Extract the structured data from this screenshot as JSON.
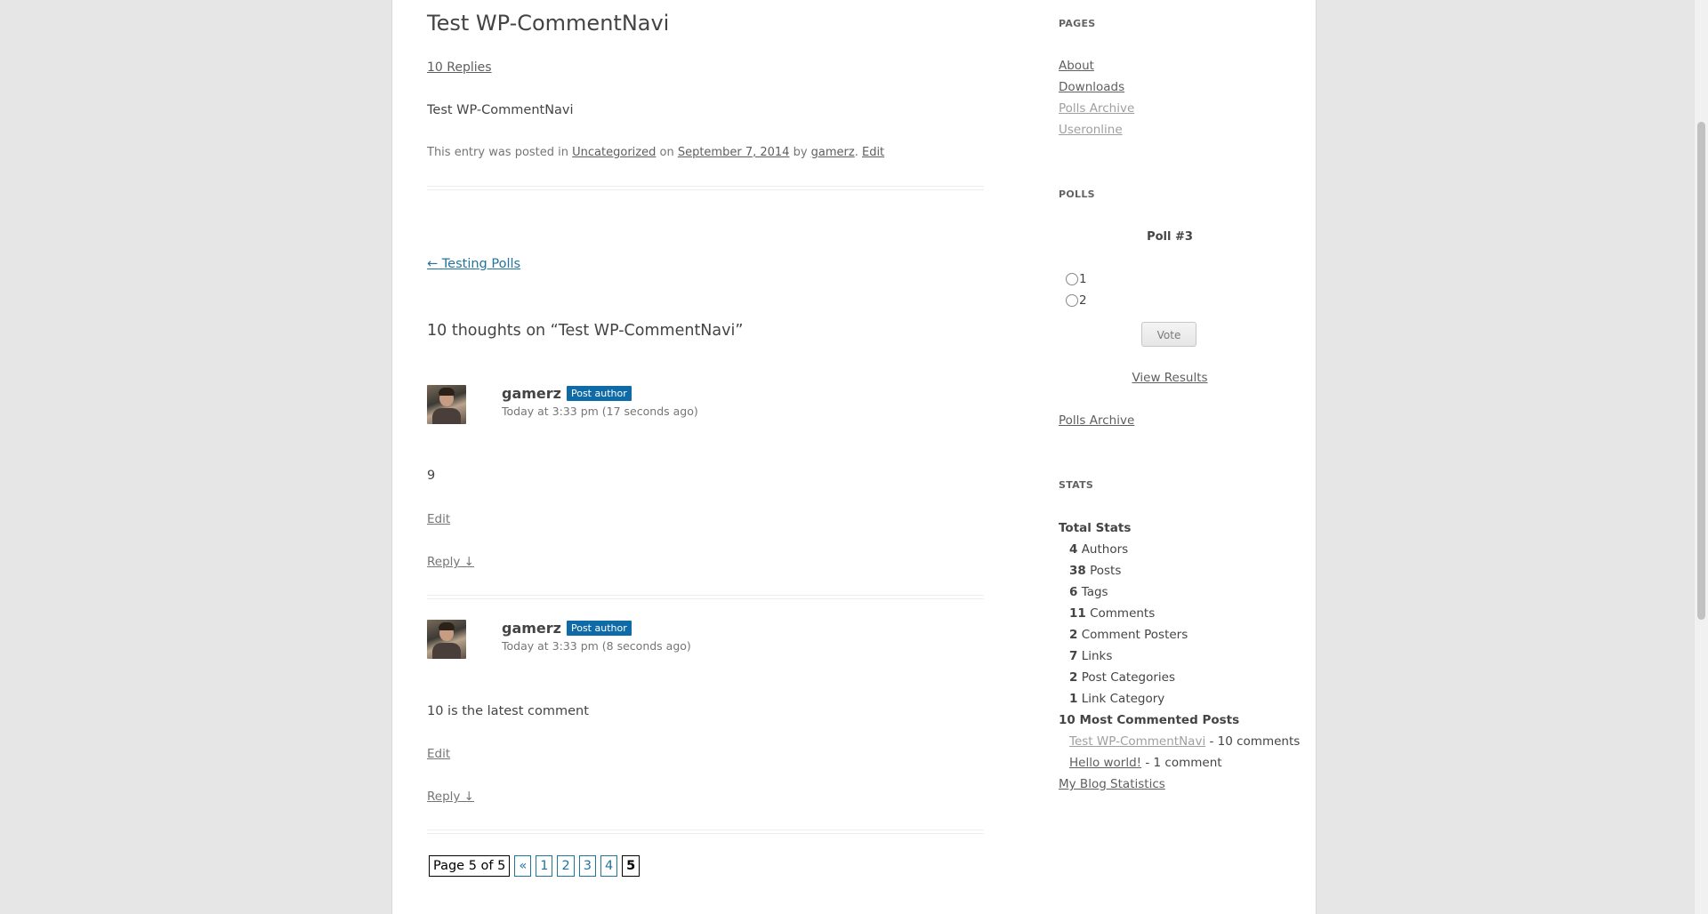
{
  "post": {
    "title": "Test WP-CommentNavi",
    "replies_link": "10 Replies",
    "body": "Test WP-CommentNavi",
    "meta_prefix": "This entry was posted in ",
    "category": "Uncategorized",
    "meta_on": " on ",
    "date": "September 7, 2014",
    "meta_by": " by ",
    "author": "gamerz",
    "meta_dot": ". ",
    "edit": "Edit"
  },
  "nav": {
    "prev_link": "← Testing Polls"
  },
  "comments": {
    "title": "10 thoughts on “Test WP-CommentNavi”",
    "items": [
      {
        "author": "gamerz",
        "badge": "Post author",
        "time": "Today at 3:33 pm (17 seconds ago)",
        "text": "9",
        "edit": "Edit",
        "reply": "Reply ↓"
      },
      {
        "author": "gamerz",
        "badge": "Post author",
        "time": "Today at 3:33 pm (8 seconds ago)",
        "text": "10 is the latest comment",
        "edit": "Edit",
        "reply": "Reply ↓"
      }
    ]
  },
  "pagination": {
    "label": "Page 5 of 5",
    "prev": "«",
    "pages": [
      "1",
      "2",
      "3",
      "4"
    ],
    "current": "5"
  },
  "sidebar": {
    "pages_title": "Pages",
    "pages": [
      "About",
      "Downloads",
      "Polls Archive",
      "Useronline"
    ],
    "polls_title": "Polls",
    "poll_question": "Poll #3",
    "poll_options": [
      "1",
      "2"
    ],
    "vote_label": "Vote",
    "view_results": "View Results",
    "polls_archive": "Polls Archive",
    "stats_title": "Stats",
    "total_stats": "Total Stats",
    "stats": [
      {
        "num": "4",
        "label": " Authors"
      },
      {
        "num": "38",
        "label": " Posts"
      },
      {
        "num": "6",
        "label": " Tags"
      },
      {
        "num": "11",
        "label": " Comments"
      },
      {
        "num": "2",
        "label": " Comment Posters"
      },
      {
        "num": "7",
        "label": " Links"
      },
      {
        "num": "2",
        "label": " Post Categories"
      },
      {
        "num": "1",
        "label": " Link Category"
      }
    ],
    "most_commented_title": "10 Most Commented Posts",
    "most_commented": [
      {
        "title": "Test WP-CommentNavi",
        "count": " - 10 comments"
      },
      {
        "title": "Hello world!",
        "count": " - 1 comment"
      }
    ],
    "my_blog_stats": "My Blog Statistics"
  },
  "colors": {
    "link_blue": "#21759b",
    "badge_blue": "#0e6ba8"
  }
}
